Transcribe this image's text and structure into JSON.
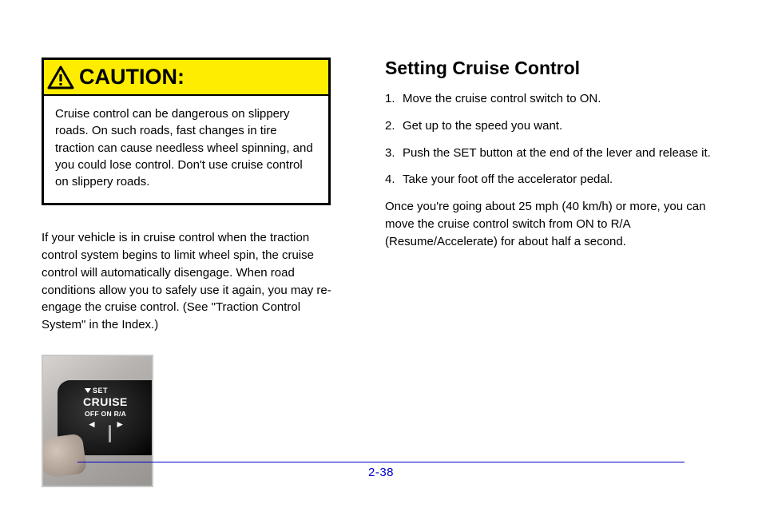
{
  "caution": {
    "label": "CAUTION:",
    "body": "Cruise control can be dangerous on slippery roads. On such roads, fast changes in tire traction can cause needless wheel spinning, and you could lose control. Don't use cruise control on slippery roads."
  },
  "below_caution": "If your vehicle is in cruise control when the traction control system begins to limit wheel spin, the cruise control will automatically disengage. When road conditions allow you to safely use it again, you may re-engage the cruise control. (See \"Traction Control System\" in the Index.)",
  "cruise_photo": {
    "set_label": "SET",
    "cruise_label": "CRUISE",
    "off_on_ra": "OFF  ON  R/A"
  },
  "right": {
    "heading": "Setting Cruise Control",
    "step1": "Move the cruise control switch to ON.",
    "step2_a": "Get up to the speed you want.",
    "step3": "Push the SET button at the end of the lever and release it.",
    "step4": "Take your foot off the accelerator pedal.",
    "body_after": "Once you're going about 25 mph (40 km/h) or more, you can move the cruise control switch from ON to R/A (Resume/Accelerate) for about half a second."
  },
  "page_number": "2-38"
}
